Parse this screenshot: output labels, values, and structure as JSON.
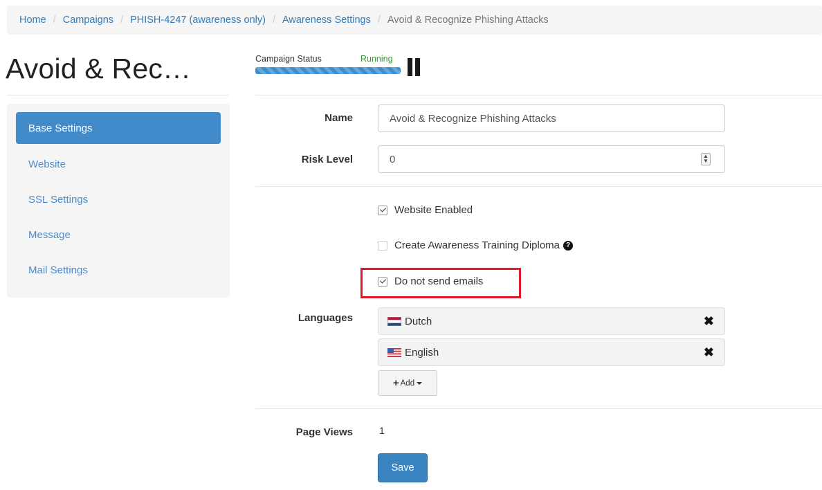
{
  "breadcrumb": [
    "Home",
    "Campaigns",
    "PHISH-4247 (awareness only)",
    "Awareness Settings",
    "Avoid & Recognize Phishing Attacks"
  ],
  "breadcrumb_separator": "/",
  "page_title": "Avoid & Rec…",
  "campaign_status": {
    "label": "Campaign Status",
    "value": "Running",
    "progress_percent": 100,
    "pause_icon": "pause-icon"
  },
  "sidebar": {
    "items": [
      {
        "label": "Base Settings",
        "active": true
      },
      {
        "label": "Website",
        "active": false
      },
      {
        "label": "SSL Settings",
        "active": false
      },
      {
        "label": "Message",
        "active": false
      },
      {
        "label": "Mail Settings",
        "active": false
      }
    ]
  },
  "form": {
    "name_label": "Name",
    "name_value": "Avoid & Recognize Phishing Attacks",
    "risk_label": "Risk Level",
    "risk_value": "0",
    "spinner_up": "▲",
    "spinner_down": "▼",
    "website_enabled": {
      "label": "Website Enabled",
      "checked": true
    },
    "diploma": {
      "label": "Create Awareness Training Diploma",
      "checked": false,
      "help_icon": "?"
    },
    "no_emails": {
      "label": "Do not send emails",
      "checked": true
    },
    "languages_label": "Languages",
    "languages": [
      {
        "name": "Dutch",
        "flag_icon": "nl-flag-icon"
      },
      {
        "name": "English",
        "flag_icon": "us-flag-icon"
      }
    ],
    "remove_icon": "✖",
    "add_plus": "+",
    "add_label": "Add",
    "page_views_label": "Page Views",
    "page_views_value": "1",
    "save_label": "Save"
  },
  "colors": {
    "link": "#337ab7",
    "active_nav": "#428bca",
    "status_running": "#3c9a3c",
    "highlight": "#e0192a",
    "save_button": "#3a83c1"
  }
}
